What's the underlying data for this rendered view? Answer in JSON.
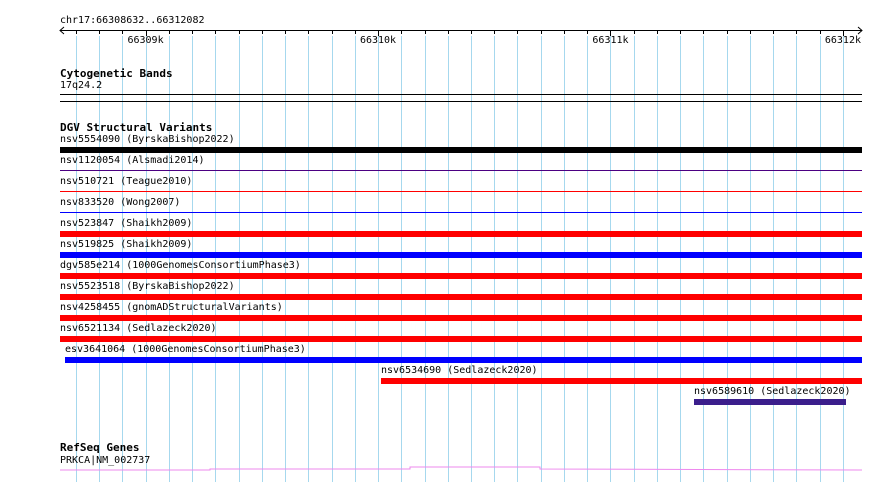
{
  "ruler": {
    "coord_label": "chr17:66308632..66312082",
    "start": 66308632,
    "end": 66312082,
    "tick_labels": [
      {
        "pos": 66309000,
        "label": "66309k"
      },
      {
        "pos": 66310000,
        "label": "66310k"
      },
      {
        "pos": 66311000,
        "label": "66311k"
      },
      {
        "pos": 66312000,
        "label": "66312k"
      }
    ]
  },
  "tracks": {
    "cyto": {
      "title": "Cytogenetic Bands",
      "band_label": "17q24.2"
    },
    "dgv": {
      "title": "DGV Structural Variants",
      "features": [
        {
          "label": "nsv5554090 (ByrskaBishop2022)",
          "start": 66308632,
          "end": 66312082,
          "color": "#000000",
          "thick": true
        },
        {
          "label": "nsv1120054 (Alsmadi2014)",
          "start": 66308632,
          "end": 66312082,
          "color": "#4b0082",
          "thick": false
        },
        {
          "label": "nsv510721 (Teague2010)",
          "start": 66308632,
          "end": 66312082,
          "color": "#ff0000",
          "thick": false
        },
        {
          "label": "nsv833520 (Wong2007)",
          "start": 66308632,
          "end": 66312082,
          "color": "#0000ff",
          "thick": false
        },
        {
          "label": "nsv523847 (Shaikh2009)",
          "start": 66308632,
          "end": 66312082,
          "color": "#ff0000",
          "thick": true
        },
        {
          "label": "nsv519825 (Shaikh2009)",
          "start": 66308632,
          "end": 66312082,
          "color": "#0000ff",
          "thick": true
        },
        {
          "label": "dgv585e214 (1000GenomesConsortiumPhase3)",
          "start": 66308632,
          "end": 66312082,
          "color": "#ff0000",
          "thick": true
        },
        {
          "label": "nsv5523518 (ByrskaBishop2022)",
          "start": 66308632,
          "end": 66312082,
          "color": "#ff0000",
          "thick": true
        },
        {
          "label": "nsv4258455 (gnomADStructuralVariants)",
          "start": 66308632,
          "end": 66312082,
          "color": "#ff0000",
          "thick": true
        },
        {
          "label": "nsv6521134 (Sedlazeck2020)",
          "start": 66308632,
          "end": 66312082,
          "color": "#ff0000",
          "thick": true
        },
        {
          "label": "esv3641064 (1000GenomesConsortiumPhase3)",
          "start": 66308654,
          "end": 66312082,
          "color": "#0000ff",
          "thick": true
        },
        {
          "label": "nsv6534690 (Sedlazeck2020)",
          "start": 66310015,
          "end": 66312082,
          "color": "#ff0000",
          "thick": true
        },
        {
          "label": "nsv6589610 (Sedlazeck2020)",
          "start": 66311360,
          "end": 66312015,
          "color": "#3b1e8c",
          "thick": true
        }
      ]
    },
    "refseq": {
      "title": "RefSeq Genes",
      "gene_label": "PRKCA|NM_002737"
    }
  },
  "colors": {
    "grid_line": "#a6d8ee",
    "gene_line": "#ee88ee"
  }
}
